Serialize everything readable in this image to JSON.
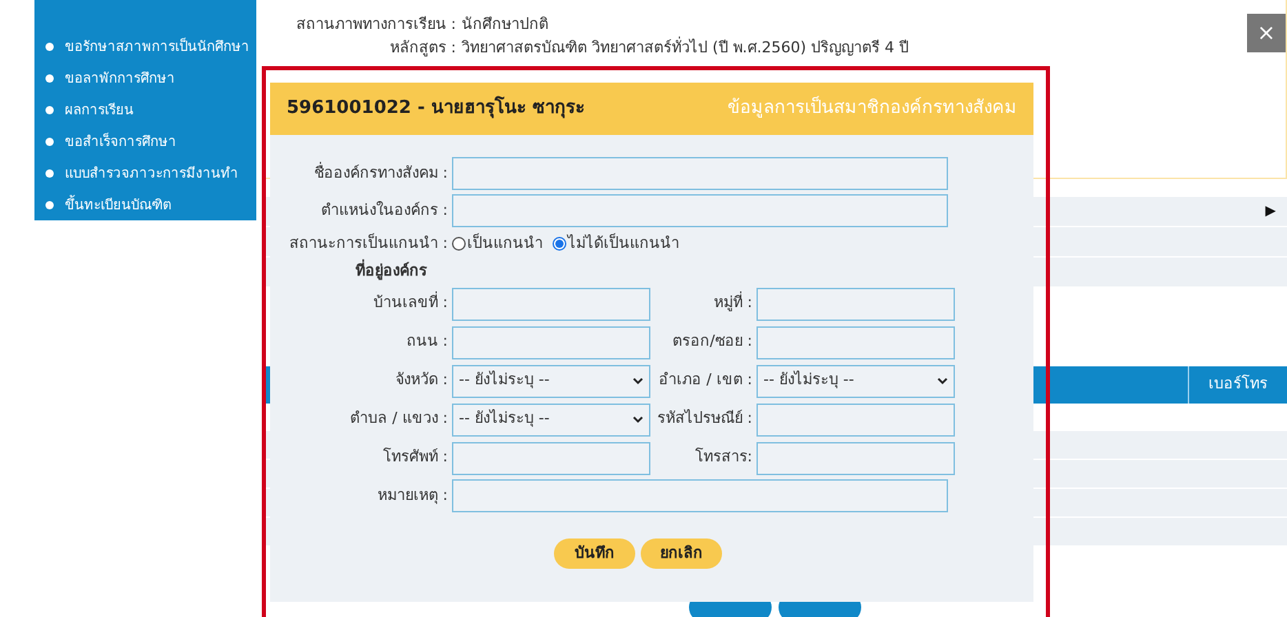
{
  "sidebar": {
    "items": [
      {
        "label": "ขอรักษาสภาพการเป็นนักศึกษา"
      },
      {
        "label": "ขอลาพักการศึกษา"
      },
      {
        "label": "ผลการเรียน"
      },
      {
        "label": "ขอสำเร็จการศึกษา"
      },
      {
        "label": "แบบสำรวจภาวะการมีงานทำ"
      },
      {
        "label": "ขึ้นทะเบียนบัณฑิต"
      }
    ]
  },
  "profile": {
    "info": [
      {
        "label": "สถานภาพทางการเรียน :",
        "value": "นักศึกษาปกติ"
      },
      {
        "label": "หลักสูตร :",
        "value": "วิทยาศาสตรบัณฑิต วิทยาศาสตร์ทั่วไป (ปี พ.ศ.2560) ปริญญาตรี 4 ปี"
      }
    ],
    "close_button": "×",
    "expand_arrow": "▶"
  },
  "table": {
    "columns": [
      "เบอร์โทร"
    ]
  },
  "dialog": {
    "title": "5961001022 - นายฮารุโนะ ซากุระ",
    "subtitle": "ข้อมูลการเป็นสมาชิกองค์กรทางสังคม",
    "org_fields": [
      {
        "label": "ชื่อองค์กรทางสังคม :"
      },
      {
        "label": "ตำแหน่งในองค์กร :"
      }
    ],
    "leader_status": {
      "label": "สถานะการเป็นแกนนำ :",
      "options": [
        {
          "label": "เป็นแกนนำ",
          "selected": false
        },
        {
          "label": "ไม่ได้เป็นแกนนำ",
          "selected": true
        }
      ]
    },
    "address": {
      "heading": "ที่อยู่องค์กร",
      "rows": [
        [
          {
            "kind": "text",
            "label": "บ้านเลขที่ :"
          },
          {
            "kind": "text",
            "label": "หมู่ที่ :"
          }
        ],
        [
          {
            "kind": "text",
            "label": "ถนน :"
          },
          {
            "kind": "text",
            "label": "ตรอก/ซอย :"
          }
        ],
        [
          {
            "kind": "select",
            "label": "จังหวัด :",
            "value": "-- ยังไม่ระบุ --"
          },
          {
            "kind": "select",
            "label": "อำเภอ / เขต :",
            "value": "-- ยังไม่ระบุ --"
          }
        ],
        [
          {
            "kind": "select",
            "label": "ตำบล / แขวง :",
            "value": "-- ยังไม่ระบุ --"
          },
          {
            "kind": "text",
            "label": "รหัสไปรษณีย์ :"
          }
        ],
        [
          {
            "kind": "text",
            "label": "โทรศัพท์ :"
          },
          {
            "kind": "text",
            "label": "โทรสาร:"
          }
        ]
      ]
    },
    "remark": {
      "label": "หมายเหตุ :"
    },
    "buttons": [
      "บันทึก",
      "ยกเลิก"
    ]
  }
}
